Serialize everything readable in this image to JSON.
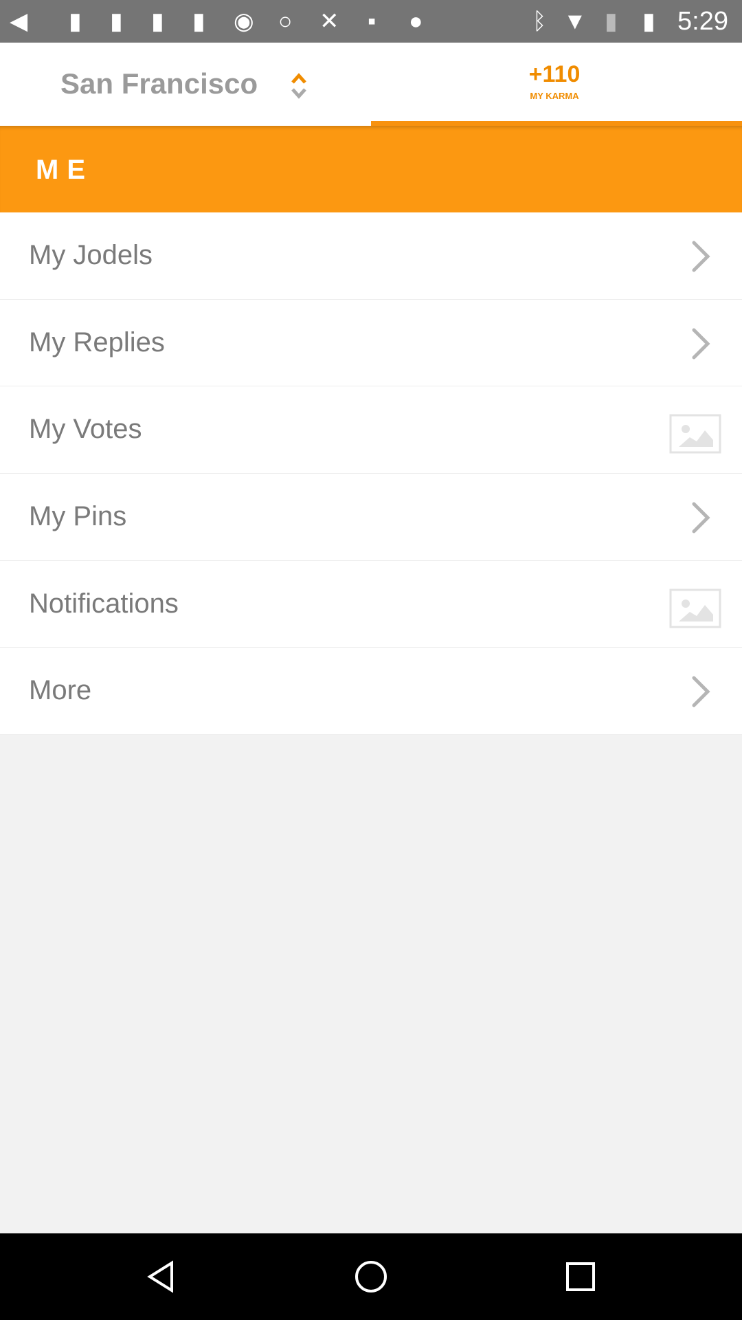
{
  "status_bar": {
    "time": "5:29"
  },
  "header": {
    "location": "San Francisco",
    "karma_value": "+110",
    "karma_label": "MY KARMA"
  },
  "section": {
    "title": "ME"
  },
  "menu": {
    "items": [
      {
        "label": "My Jodels",
        "icon": "chevron-right"
      },
      {
        "label": "My Replies",
        "icon": "chevron-right"
      },
      {
        "label": "My Votes",
        "icon": "image-placeholder"
      },
      {
        "label": "My Pins",
        "icon": "chevron-right"
      },
      {
        "label": "Notifications",
        "icon": "image-placeholder"
      },
      {
        "label": "More",
        "icon": "chevron-right"
      }
    ]
  },
  "colors": {
    "accent": "#fc9811",
    "status_bar": "#757575"
  }
}
